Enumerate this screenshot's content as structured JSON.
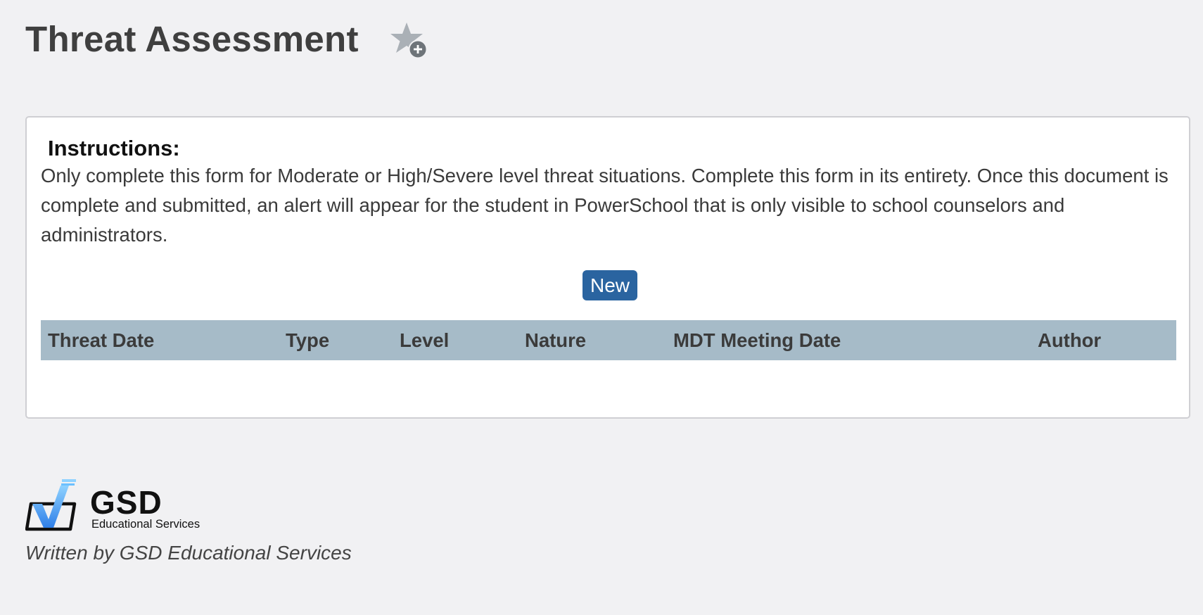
{
  "header": {
    "title": "Threat Assessment",
    "favorite_icon": "star-add-icon"
  },
  "instructions": {
    "heading": "Instructions:",
    "text": "Only complete this form for Moderate or High/Severe level threat situations. Complete this form in its entirety. Once this document is complete and submitted, an alert will appear for the student in PowerSchool that is only visible to school counselors and administrators."
  },
  "actions": {
    "new_label": "New"
  },
  "table": {
    "columns": [
      "Threat Date",
      "Type",
      "Level",
      "Nature",
      "MDT Meeting Date",
      "Author"
    ],
    "rows": []
  },
  "footer": {
    "logo_main": "GSD",
    "logo_sub": "Educational Services",
    "written_by": "Written by GSD Educational Services"
  },
  "colors": {
    "page_background": "#f1f1f3",
    "button": "#2a64a0",
    "table_header": "#a6bbc8",
    "logo_blue": "#3aa0f0"
  }
}
